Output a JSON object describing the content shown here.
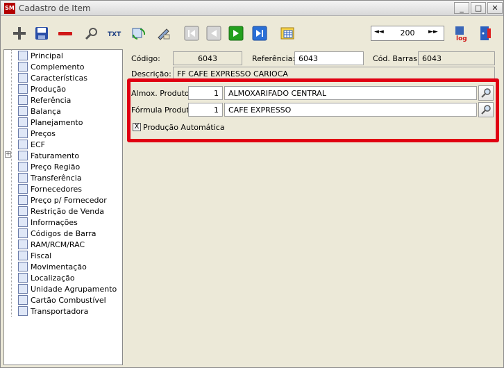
{
  "window": {
    "title": "Cadastro de Item",
    "app_icon": "app-logo-icon"
  },
  "toolbar": {
    "buttons": [
      {
        "name": "add-icon"
      },
      {
        "name": "save-icon"
      },
      {
        "name": "delete-icon"
      },
      {
        "name": "search-icon"
      },
      {
        "name": "txt-export-icon",
        "label": "TXT"
      },
      {
        "name": "refresh-grid-icon"
      },
      {
        "name": "edit-icon"
      },
      {
        "name": "first-record-icon"
      },
      {
        "name": "prev-record-icon"
      },
      {
        "name": "next-record-icon"
      },
      {
        "name": "last-record-icon"
      },
      {
        "name": "spreadsheet-icon"
      },
      {
        "name": "log-icon",
        "label": "log"
      },
      {
        "name": "exit-icon"
      }
    ],
    "pager": {
      "first": "◄◄",
      "last": "►►",
      "value": "200"
    }
  },
  "tree": {
    "items": [
      {
        "label": "Principal"
      },
      {
        "label": "Complemento"
      },
      {
        "label": "Características"
      },
      {
        "label": "Produção"
      },
      {
        "label": "Referência"
      },
      {
        "label": "Balança"
      },
      {
        "label": "Planejamento"
      },
      {
        "label": "Preços"
      },
      {
        "label": "ECF"
      },
      {
        "label": "Faturamento",
        "expander": "+"
      },
      {
        "label": "Preço Região"
      },
      {
        "label": "Transferência"
      },
      {
        "label": "Fornecedores"
      },
      {
        "label": "Preço p/ Fornecedor"
      },
      {
        "label": "Restrição de Venda"
      },
      {
        "label": "Informações"
      },
      {
        "label": "Códigos de Barra"
      },
      {
        "label": "RAM/RCM/RAC"
      },
      {
        "label": "Fiscal"
      },
      {
        "label": "Movimentação"
      },
      {
        "label": "Localização"
      },
      {
        "label": "Unidade Agrupamento"
      },
      {
        "label": "Cartão Combustível"
      },
      {
        "label": "Transportadora"
      }
    ]
  },
  "form": {
    "codigo_label": "Código:",
    "codigo_value": "6043",
    "referencia_label": "Referência:",
    "referencia_value": "6043",
    "cod_barras_label": "Cód. Barras:",
    "cod_barras_value": "6043",
    "descricao_label": "Descrição:",
    "descricao_value": "FF CAFE EXPRESSO CARIOCA",
    "almox_label": "Almox. Produto:",
    "almox_code": "1",
    "almox_name": "ALMOXARIFADO CENTRAL",
    "formula_label": "Fórmula Produto:",
    "formula_code": "1",
    "formula_name": "CAFE EXPRESSO",
    "producao_label": "Produção Automática",
    "producao_checked": "X"
  },
  "colors": {
    "highlight": "#e00012"
  }
}
